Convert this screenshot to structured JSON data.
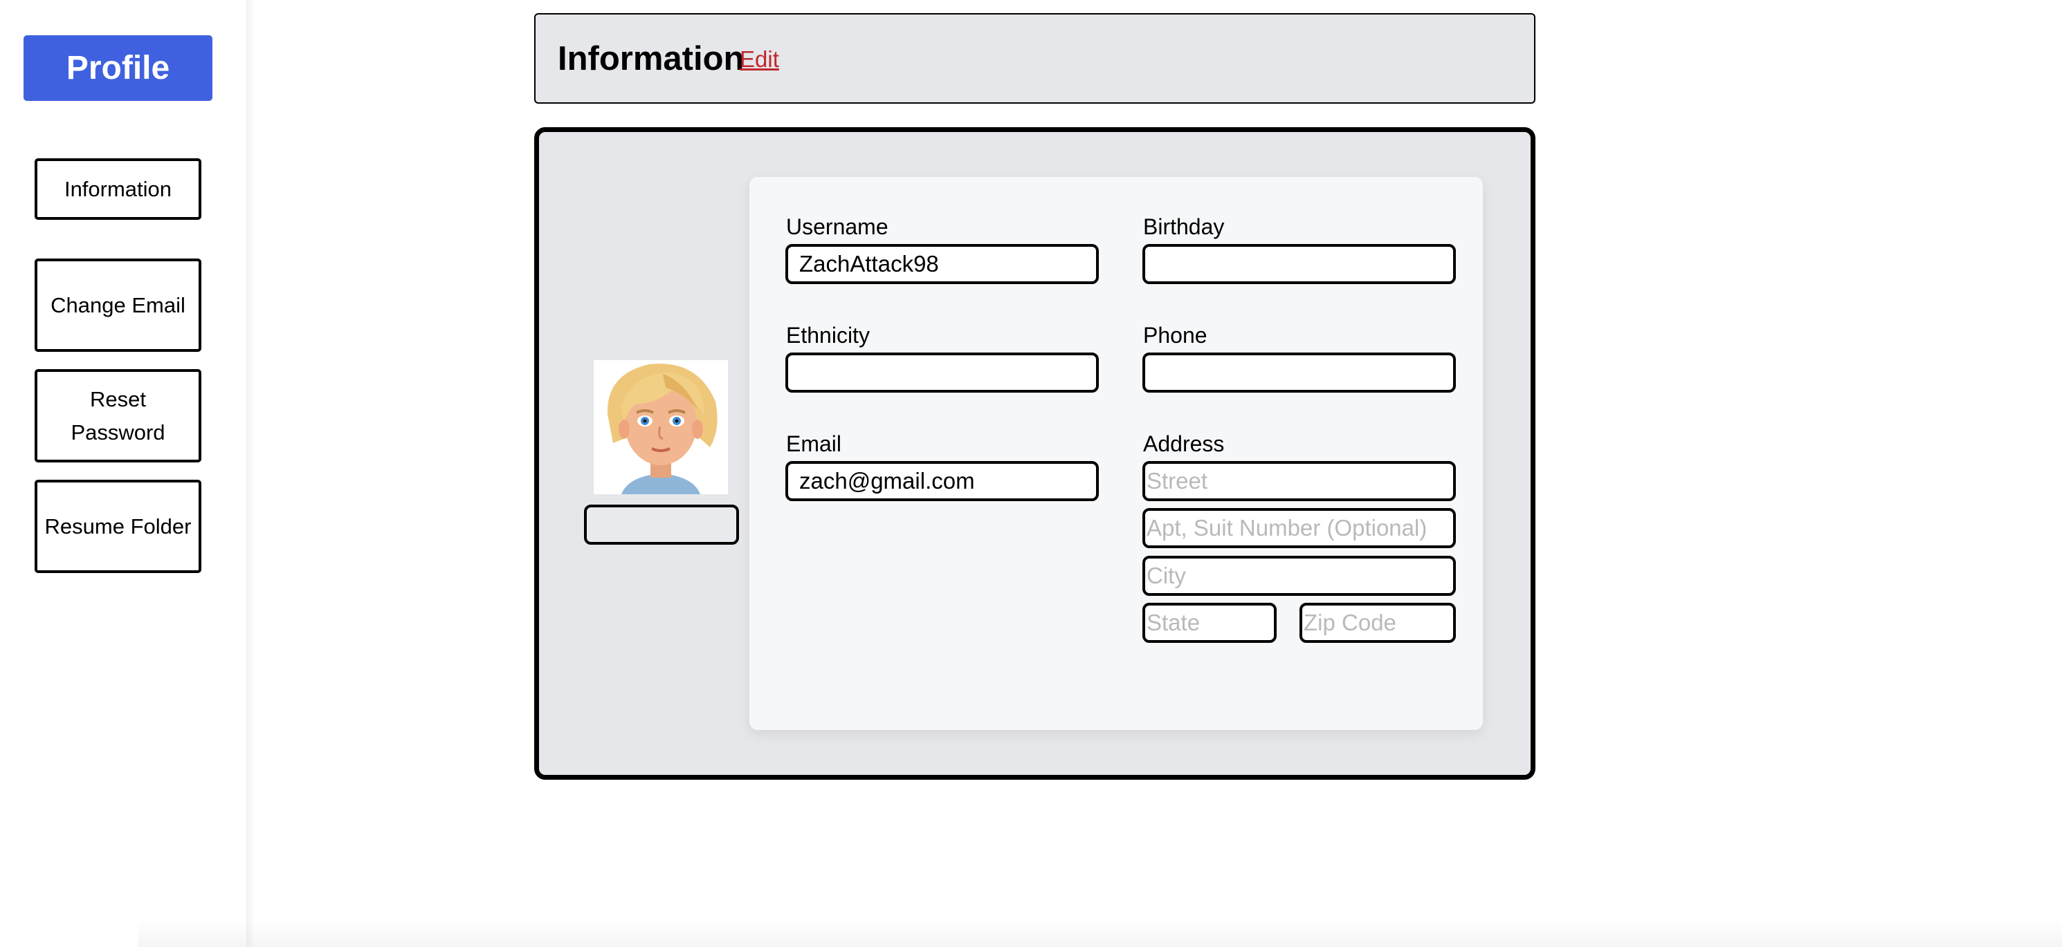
{
  "sidebar": {
    "profile_label": "Profile",
    "items": [
      {
        "label": "Information"
      },
      {
        "label": "Change Email"
      },
      {
        "label": "Reset Password"
      },
      {
        "label": "Resume Folder"
      }
    ]
  },
  "header": {
    "title": "Information",
    "edit_label": "Edit"
  },
  "form": {
    "username": {
      "label": "Username",
      "value": "ZachAttack98"
    },
    "birthday": {
      "label": "Birthday",
      "value": ""
    },
    "ethnicity": {
      "label": "Ethnicity",
      "value": ""
    },
    "phone": {
      "label": "Phone",
      "value": ""
    },
    "email": {
      "label": "Email",
      "value": "zach@gmail.com"
    },
    "address": {
      "label": "Address",
      "street_placeholder": "Street",
      "apt_placeholder": "Apt, Suit Number (Optional)",
      "city_placeholder": "City",
      "state_placeholder": "State",
      "zip_placeholder": "Zip Code"
    }
  },
  "colors": {
    "accent": "#4061df",
    "edit_link": "#c0282d",
    "card_bg": "#e6e7ea",
    "panel_bg": "#f6f7f9"
  },
  "icons": {
    "avatar": "cartoon-person-avatar"
  }
}
